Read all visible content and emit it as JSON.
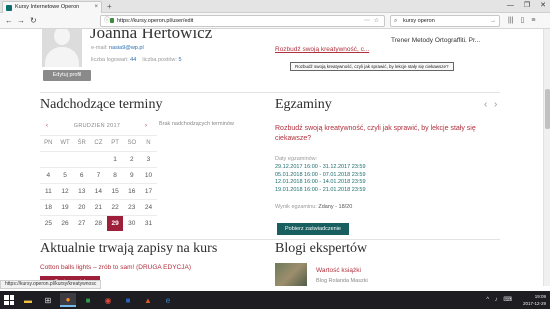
{
  "browser": {
    "tab_title": "Kursy Internetowe Operon",
    "tab_close": "×",
    "new_tab": "+",
    "window_controls": [
      "—",
      "❐",
      "✕"
    ],
    "back": "←",
    "forward": "→",
    "reload": "↻",
    "url": "https://kursy.operon.pl/user/edit",
    "search_text": "kursy operon",
    "search_go": "→",
    "toolbar_icons": [
      "library-icon",
      "sidebar-icon",
      "menu-icon"
    ]
  },
  "profile": {
    "name": "Joanna Hertowicz",
    "email_label": "e-mail:",
    "email": "nasia9@wp.pl",
    "logins_label": "liczba logowań:",
    "logins": "44",
    "posts_label": "liczba postów:",
    "posts": "5",
    "edit_button": "Edytuj profil"
  },
  "course_header": {
    "title": "Trener Metody Ortograffiti. Pr...",
    "link": "Rozbudź swoją kreatywność, c...",
    "tooltip": "Rozbudź swoją kreatywność, czyli jak sprawić, by lekcje stały się ciekawsze?"
  },
  "terms": {
    "heading": "Nadchodzące terminy",
    "month": "GRUDZIEŃ 2017",
    "prev": "‹",
    "next": "›",
    "no_terms": "Brak nadchodzących terminów",
    "weekdays": [
      "PN",
      "WT",
      "ŚR",
      "CZ",
      "PT",
      "SO",
      "N"
    ],
    "weeks": [
      [
        "",
        "",
        "",
        "",
        "1",
        "2",
        "3"
      ],
      [
        "4",
        "5",
        "6",
        "7",
        "8",
        "9",
        "10"
      ],
      [
        "11",
        "12",
        "13",
        "14",
        "15",
        "16",
        "17"
      ],
      [
        "18",
        "19",
        "20",
        "21",
        "22",
        "23",
        "24"
      ],
      [
        "25",
        "26",
        "27",
        "28",
        "29",
        "30",
        "31"
      ]
    ],
    "today": "29"
  },
  "exams": {
    "heading": "Egzaminy",
    "prev": "‹",
    "next": "›",
    "name": "Rozbudź swoją kreatywność, czyli jak sprawić, by lekcje stały się ciekawsze?",
    "dates_label": "Daty egzaminów:",
    "dates": [
      "29.12.2017 16:00 - 31.12.2017 23:59",
      "05.01.2018 16:00 - 07.01.2018 23:59",
      "12.01.2018 16:00 - 14.01.2018 23:59",
      "19.01.2018 16:00 - 21.01.2018 23:59"
    ],
    "result_label": "Wynik egzaminu:",
    "result": "Zdany - 18/20",
    "cert_button": "Pobierz zaświadczenie"
  },
  "current": {
    "heading": "Aktualnie trwają zapisy na kurs",
    "course": "Cotton balls lights – zrób to sam! (DRUGA EDYCJA)",
    "enroll_button": "Zapisz mnie!"
  },
  "blogs": {
    "heading": "Blogi ekspertów",
    "title": "Wartość książki",
    "author": "Blog Rolanda Maszki"
  },
  "status_url": "https://kursy.operon.pl/kursy/kreatywnosc",
  "taskbar": {
    "apps": [
      "explorer-icon",
      "store-icon",
      "firefox-icon",
      "excel-icon",
      "chrome-icon",
      "word-icon",
      "photo-icon",
      "edge-icon"
    ],
    "time": "19:09",
    "date": "2017-12-29",
    "tray": "^ ♪ ⌨"
  },
  "colors": {
    "accent_red": "#b0303e",
    "today_bg": "#9e1f3a",
    "teal": "#1a5f5f"
  }
}
